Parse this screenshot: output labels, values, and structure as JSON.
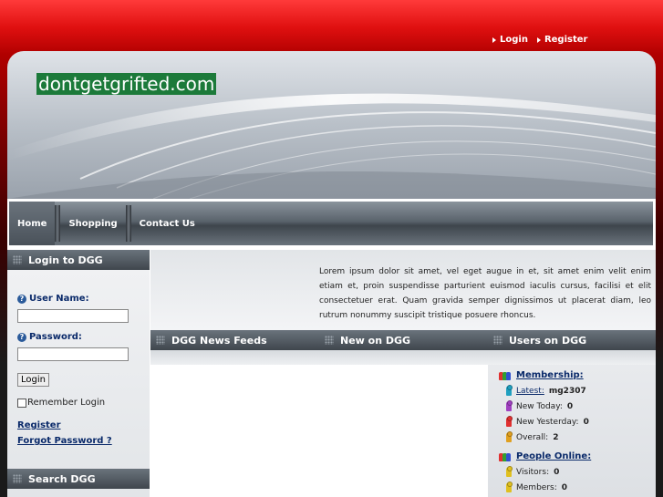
{
  "top_links": [
    {
      "label": "Login",
      "icon": "arrow-right-icon"
    },
    {
      "label": "Register",
      "icon": "arrow-right-icon"
    }
  ],
  "site": {
    "logo_text": "dontgetgrifted.com"
  },
  "nav": {
    "items": [
      {
        "label": "Home",
        "active": true
      },
      {
        "label": "Shopping",
        "active": false
      },
      {
        "label": "Contact Us",
        "active": false
      }
    ]
  },
  "login_module": {
    "title": "Login to DGG",
    "username_label": "User Name:",
    "username_value": "",
    "password_label": "Password:",
    "password_value": "",
    "login_button": "Login",
    "remember_label": "Remember Login",
    "register_link": "Register",
    "forgot_link": "Forgot Password ?"
  },
  "search_module": {
    "title": "Search DGG"
  },
  "intro_text": "Lorem ipsum dolor sit amet, vel eget augue in et, sit amet enim velit enim etiam et, proin suspendisse parturient euismod iaculis cursus, facilisi et elit consectetuer erat. Quam gravida semper dignissimos ut placerat diam, leo rutrum nonummy suscipit tristique posuere rhoncus.",
  "columns": [
    {
      "title": "DGG News Feeds"
    },
    {
      "title": "New on DGG"
    },
    {
      "title": "Users on DGG"
    }
  ],
  "users": {
    "membership_title": "Membership:",
    "latest_label": "Latest:",
    "latest_value": "mg2307",
    "new_today_label": "New Today:",
    "new_today_value": "0",
    "new_yesterday_label": "New Yesterday:",
    "new_yesterday_value": "0",
    "overall_label": "Overall:",
    "overall_value": "2",
    "online_title": "People Online:",
    "visitors_label": "Visitors:",
    "visitors_value": "0",
    "members_label": "Members:",
    "members_value": "0"
  },
  "colors": {
    "accent_red": "#e01010",
    "logo_bg": "#1c7a3a",
    "link_blue": "#0a2a6a"
  }
}
